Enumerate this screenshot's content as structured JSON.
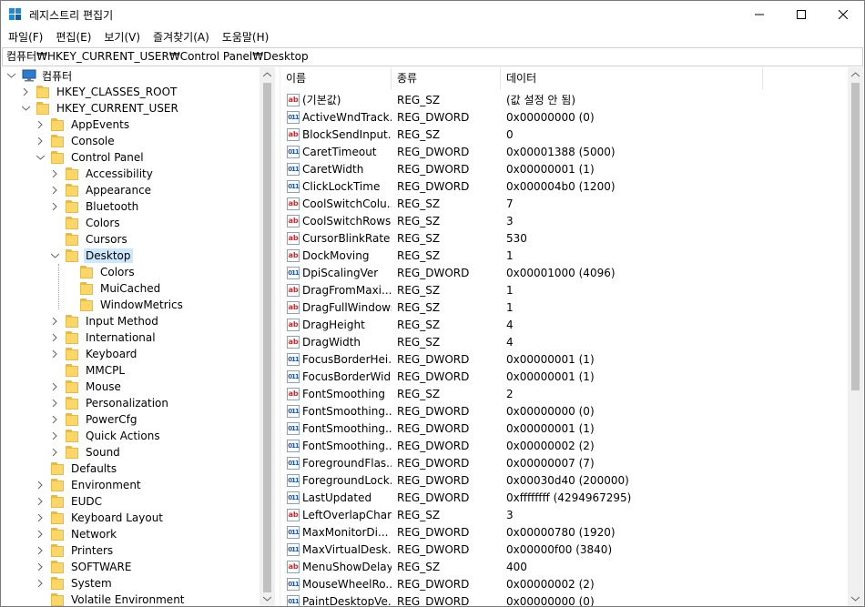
{
  "window": {
    "title": "레지스트리 편집기",
    "accent": "#1f8ad8"
  },
  "menu": [
    "파일(F)",
    "편집(E)",
    "보기(V)",
    "즐겨찾기(A)",
    "도움말(H)"
  ],
  "address": "컴퓨터₩HKEY_CURRENT_USER₩Control Panel₩Desktop",
  "tree": {
    "root": "컴퓨터",
    "hives": [
      "HKEY_CLASSES_ROOT",
      "HKEY_CURRENT_USER"
    ],
    "hkcu_children_top": [
      "AppEvents",
      "Console",
      "Control Panel"
    ],
    "control_panel_children": [
      "Accessibility",
      "Appearance",
      "Bluetooth",
      "Colors",
      "Cursors",
      "Desktop"
    ],
    "desktop_children": [
      "Colors",
      "MuiCached",
      "WindowMetrics"
    ],
    "control_panel_children_after": [
      "Input Method",
      "International",
      "Keyboard",
      "MMCPL",
      "Mouse",
      "Personalization",
      "PowerCfg",
      "Quick Actions",
      "Sound"
    ],
    "hkcu_children_bottom": [
      "Defaults",
      "Environment",
      "EUDC",
      "Keyboard Layout",
      "Network",
      "Printers",
      "SOFTWARE",
      "System",
      "Volatile Environment"
    ]
  },
  "list": {
    "headers": [
      "이름",
      "종류",
      "데이터"
    ],
    "rows": [
      {
        "name": "(기본값)",
        "type": "REG_SZ",
        "data": "(값 설정 안 됨)",
        "icon": "string-value-icon"
      },
      {
        "name": "ActiveWndTrack...",
        "type": "REG_DWORD",
        "data": "0x00000000 (0)",
        "icon": "dword-value-icon"
      },
      {
        "name": "BlockSendInput...",
        "type": "REG_SZ",
        "data": "0",
        "icon": "string-value-icon"
      },
      {
        "name": "CaretTimeout",
        "type": "REG_DWORD",
        "data": "0x00001388 (5000)",
        "icon": "dword-value-icon"
      },
      {
        "name": "CaretWidth",
        "type": "REG_DWORD",
        "data": "0x00000001 (1)",
        "icon": "dword-value-icon"
      },
      {
        "name": "ClickLockTime",
        "type": "REG_DWORD",
        "data": "0x000004b0 (1200)",
        "icon": "dword-value-icon"
      },
      {
        "name": "CoolSwitchColu...",
        "type": "REG_SZ",
        "data": "7",
        "icon": "string-value-icon"
      },
      {
        "name": "CoolSwitchRows",
        "type": "REG_SZ",
        "data": "3",
        "icon": "string-value-icon"
      },
      {
        "name": "CursorBlinkRate",
        "type": "REG_SZ",
        "data": "530",
        "icon": "string-value-icon"
      },
      {
        "name": "DockMoving",
        "type": "REG_SZ",
        "data": "1",
        "icon": "string-value-icon"
      },
      {
        "name": "DpiScalingVer",
        "type": "REG_DWORD",
        "data": "0x00001000 (4096)",
        "icon": "dword-value-icon"
      },
      {
        "name": "DragFromMaxi...",
        "type": "REG_SZ",
        "data": "1",
        "icon": "string-value-icon"
      },
      {
        "name": "DragFullWindows",
        "type": "REG_SZ",
        "data": "1",
        "icon": "string-value-icon"
      },
      {
        "name": "DragHeight",
        "type": "REG_SZ",
        "data": "4",
        "icon": "string-value-icon"
      },
      {
        "name": "DragWidth",
        "type": "REG_SZ",
        "data": "4",
        "icon": "string-value-icon"
      },
      {
        "name": "FocusBorderHei...",
        "type": "REG_DWORD",
        "data": "0x00000001 (1)",
        "icon": "dword-value-icon"
      },
      {
        "name": "FocusBorderWid...",
        "type": "REG_DWORD",
        "data": "0x00000001 (1)",
        "icon": "dword-value-icon"
      },
      {
        "name": "FontSmoothing",
        "type": "REG_SZ",
        "data": "2",
        "icon": "string-value-icon"
      },
      {
        "name": "FontSmoothing...",
        "type": "REG_DWORD",
        "data": "0x00000000 (0)",
        "icon": "dword-value-icon"
      },
      {
        "name": "FontSmoothing...",
        "type": "REG_DWORD",
        "data": "0x00000001 (1)",
        "icon": "dword-value-icon"
      },
      {
        "name": "FontSmoothing...",
        "type": "REG_DWORD",
        "data": "0x00000002 (2)",
        "icon": "dword-value-icon"
      },
      {
        "name": "ForegroundFlas...",
        "type": "REG_DWORD",
        "data": "0x00000007 (7)",
        "icon": "dword-value-icon"
      },
      {
        "name": "ForegroundLock...",
        "type": "REG_DWORD",
        "data": "0x00030d40 (200000)",
        "icon": "dword-value-icon"
      },
      {
        "name": "LastUpdated",
        "type": "REG_DWORD",
        "data": "0xffffffff (4294967295)",
        "icon": "dword-value-icon"
      },
      {
        "name": "LeftOverlapChars",
        "type": "REG_SZ",
        "data": "3",
        "icon": "string-value-icon"
      },
      {
        "name": "MaxMonitorDi...",
        "type": "REG_DWORD",
        "data": "0x00000780 (1920)",
        "icon": "dword-value-icon"
      },
      {
        "name": "MaxVirtualDesk...",
        "type": "REG_DWORD",
        "data": "0x00000f00 (3840)",
        "icon": "dword-value-icon"
      },
      {
        "name": "MenuShowDelay",
        "type": "REG_SZ",
        "data": "400",
        "icon": "string-value-icon"
      },
      {
        "name": "MouseWheelRo...",
        "type": "REG_DWORD",
        "data": "0x00000002 (2)",
        "icon": "dword-value-icon"
      },
      {
        "name": "PaintDesktopVe...",
        "type": "REG_DWORD",
        "data": "0x00000000 (0)",
        "icon": "dword-value-icon"
      }
    ]
  },
  "icons": {
    "string_glyph": "ab",
    "dword_glyph": "011"
  }
}
